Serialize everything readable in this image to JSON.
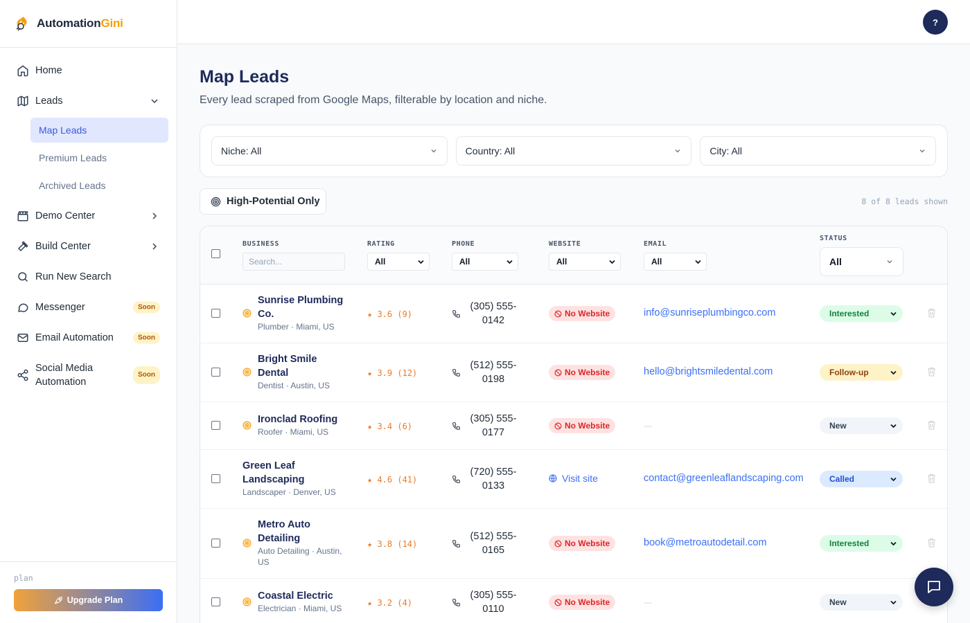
{
  "brand": {
    "name_main": "Automation",
    "name_accent": "Gini"
  },
  "sidebar": {
    "items": [
      {
        "label": "Home"
      },
      {
        "label": "Leads"
      },
      {
        "label": "Demo Center"
      },
      {
        "label": "Build Center"
      },
      {
        "label": "Run New Search"
      },
      {
        "label": "Messenger",
        "badge": "Soon"
      },
      {
        "label": "Email Automation",
        "badge": "Soon"
      },
      {
        "label": "Social Media Automation",
        "label_line1": "Social Media",
        "label_line2": "Automation",
        "badge": "Soon"
      }
    ],
    "leads_sub": [
      "Map Leads",
      "Premium Leads",
      "Archived Leads"
    ],
    "plan_label": "plan",
    "upgrade_label": "Upgrade Plan"
  },
  "topbar": {
    "help": "?"
  },
  "page": {
    "title": "Map Leads",
    "subtitle": "Every lead scraped from Google Maps, filterable by location and niche."
  },
  "filters": {
    "niche": "Niche: All",
    "country": "Country: All",
    "city": "City: All"
  },
  "high_potential_label": "High-Potential Only",
  "lead_count": "8 of 8 leads shown",
  "table": {
    "headers": {
      "business": "BUSINESS",
      "rating": "RATING",
      "phone": "PHONE",
      "website": "WEBSITE",
      "email": "EMAIL",
      "status": "STATUS"
    },
    "search_placeholder": "Search...",
    "rating_filter": "All",
    "phone_filter": "All",
    "website_filter": "All",
    "email_filter": "All",
    "status_filter": "All",
    "rows": [
      {
        "name1": "Sunrise Plumbing",
        "name2": "Co.",
        "meta": "Plumber · Miami, US",
        "rating": "★ 3.6 (9)",
        "phone1": "(305) 555-",
        "phone2": "0142",
        "website": "No Website",
        "email": "info@sunriseplumbingco.com",
        "status": "Interested"
      },
      {
        "name1": "Bright Smile",
        "name2": "Dental",
        "meta": "Dentist · Austin, US",
        "rating": "★ 3.9 (12)",
        "phone1": "(512) 555-",
        "phone2": "0198",
        "website": "No Website",
        "email": "hello@brightsmiledental.com",
        "status": "Follow-up"
      },
      {
        "name1": "Ironclad Roofing",
        "meta": "Roofer · Miami, US",
        "rating": "★ 3.4 (6)",
        "phone1": "(305) 555-",
        "phone2": "0177",
        "website": "No Website",
        "email": "—",
        "status": "New"
      },
      {
        "name1": "Green Leaf",
        "name2": "Landscaping",
        "meta": "Landscaper · Denver, US",
        "rating": "★ 4.6 (41)",
        "phone1": "(720) 555-",
        "phone2": "0133",
        "website": "Visit site",
        "email": "contact@greenleaflandscaping.com",
        "status": "Called"
      },
      {
        "name1": "Metro Auto",
        "name2": "Detailing",
        "meta1": "Auto Detailing · Austin,",
        "meta2": "US",
        "rating": "★ 3.8 (14)",
        "phone1": "(512) 555-",
        "phone2": "0165",
        "website": "No Website",
        "email": "book@metroautodetail.com",
        "status": "Interested"
      },
      {
        "name1": "Coastal Electric",
        "meta": "Electrician · Miami, US",
        "rating": "★ 3.2 (4)",
        "phone1": "(305) 555-",
        "phone2": "0110",
        "website": "No Website",
        "email": "—",
        "status": "New"
      }
    ]
  },
  "colors": {
    "accent": "#3b5bdb",
    "brand_orange": "#f59e0b",
    "navy": "#1e2a5a",
    "interested_bg": "#dcfce7",
    "interested_fg": "#15803d",
    "followup_bg": "#fef3c7",
    "followup_fg": "#92400e",
    "new_bg": "#f1f5f9",
    "new_fg": "#334155",
    "called_bg": "#dbeafe",
    "called_fg": "#1d4ed8",
    "no_website_bg": "#fee2e2",
    "no_website_fg": "#dc2626"
  },
  "icons": [
    "home-icon",
    "map-icon",
    "clapperboard-icon",
    "hammer-icon",
    "search-icon",
    "message-circle-icon",
    "mail-icon",
    "share-icon",
    "rocket-icon",
    "target-icon",
    "phone-icon",
    "ban-icon",
    "globe-icon",
    "trash-icon",
    "chat-icon",
    "chevron-down-icon",
    "chevron-right-icon"
  ]
}
